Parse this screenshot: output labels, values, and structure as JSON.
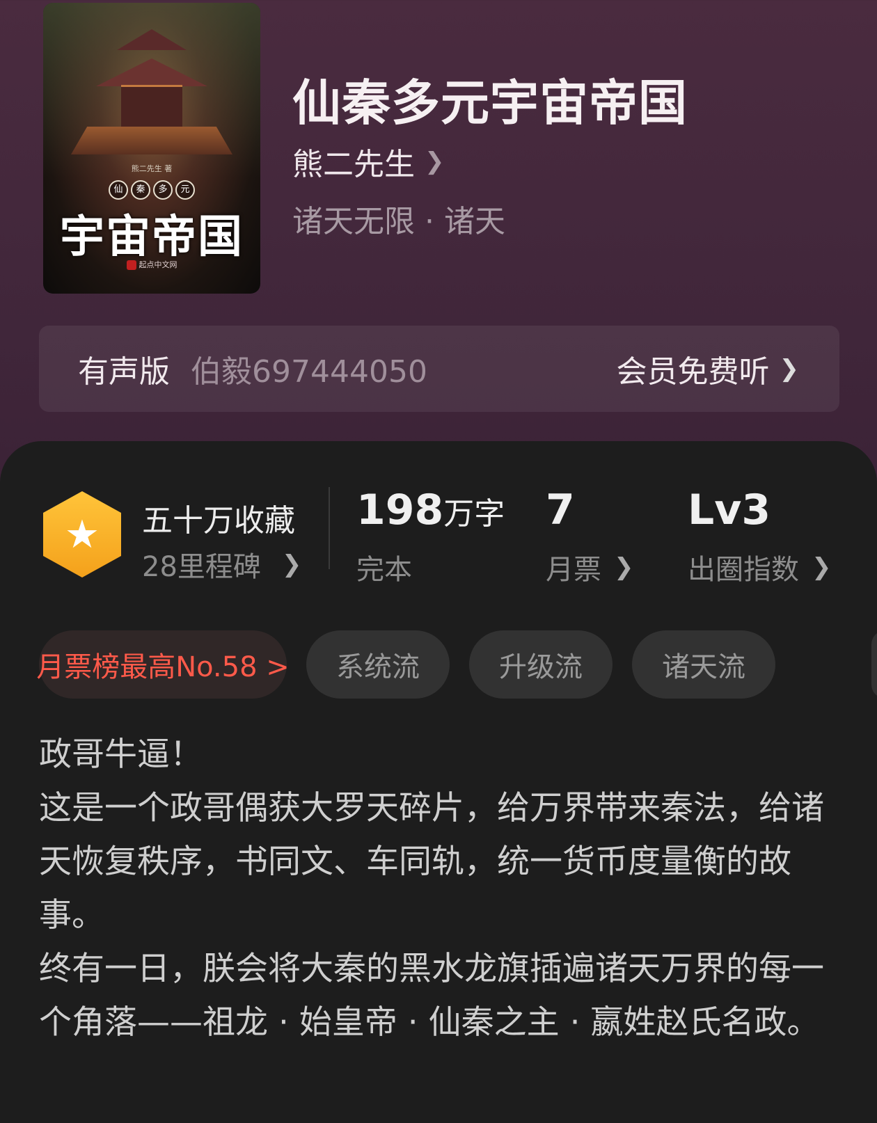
{
  "book": {
    "title": "仙秦多元宇宙帝国",
    "author": "熊二先生",
    "genre": "诸天无限 · 诸天"
  },
  "cover": {
    "author_small": "熊二先生 著",
    "circle_chars": [
      "仙",
      "秦",
      "多",
      "元"
    ],
    "big_text": "宇宙帝国",
    "publisher": "起点中文网"
  },
  "audio": {
    "label": "有声版",
    "narrator": "伯毅697444050",
    "cta": "会员免费听"
  },
  "stats": {
    "favorites": "五十万收藏",
    "milestones": "28里程碑",
    "words_num": "198",
    "words_unit": "万字",
    "status": "完本",
    "monthly_tickets": "7",
    "monthly_tickets_label": "月票",
    "level": "Lv3",
    "level_label": "出圈指数"
  },
  "tags": {
    "rank": "月票榜最高No.58 >",
    "items": [
      "系统流",
      "升级流",
      "诸天流"
    ]
  },
  "description": [
    "政哥牛逼！",
    "这是一个政哥偶获大罗天碎片，给万界带来秦法，给诸天恢复秩序，书同文、车同轨，统一货币度量衡的故事。",
    "终有一日，朕会将大秦的黑水龙旗插遍诸天万界的每一个角落——祖龙 · 始皇帝 · 仙秦之主 · 嬴姓赵氏名政。"
  ],
  "colors": {
    "rank_tag": "#ff5a4a",
    "badge": "#f4a11b"
  }
}
